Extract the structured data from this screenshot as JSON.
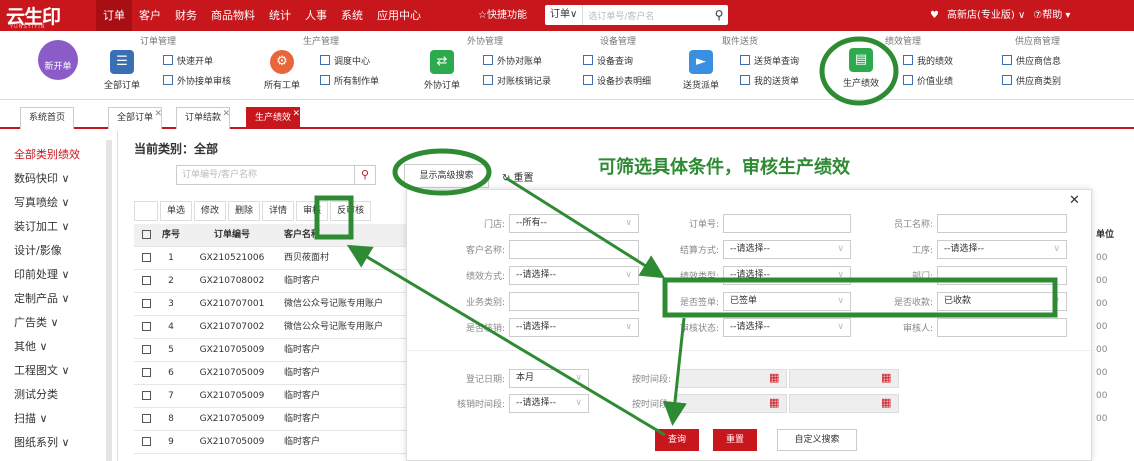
{
  "app": {
    "logo": "云生印",
    "logo_sub": "YUNSYIYIN"
  },
  "topnav": [
    "订单",
    "客户",
    "财务",
    "商品物料",
    "统计",
    "人事",
    "系统",
    "应用中心"
  ],
  "quick": "☆快捷功能",
  "search": {
    "select": "订单∨",
    "placeholder": "选订单号/客户名"
  },
  "tright": {
    "shop": "高新店(专业版) ∨",
    "help": "⑦帮助 ▾"
  },
  "ribbon": {
    "groups": [
      "订单管理",
      "生产管理",
      "外协管理",
      "设备管理",
      "取件送货",
      "绩效管理",
      "供应商管理"
    ],
    "new": "新开单",
    "all_order": "全部订单",
    "quick_open": "快速开单",
    "outsource_audit": "外协接单审核",
    "all_work": "所有工单",
    "dispatch": "调度中心",
    "all_make": "所有制作单",
    "out_order": "外协订单",
    "out_check": "外协对账单",
    "check_record": "对账核销记录",
    "dev_query": "设备查询",
    "dev_copy": "设备抄表明细",
    "send": "送货派单",
    "send_query": "送货单查询",
    "my_send": "我的送货单",
    "perf": "生产绩效",
    "my_perf": "我的绩效",
    "value_perf": "价值业绩",
    "sup_info": "供应商信息",
    "sup_type": "供应商类别"
  },
  "tabs": [
    "系统首页",
    "全部订单",
    "订单结款",
    "生产绩效"
  ],
  "sidebar": [
    "全部类别绩效",
    "数码快印 ∨",
    "写真喷绘 ∨",
    "装订加工 ∨",
    "设计/影像",
    "印前处理 ∨",
    "定制产品 ∨",
    "广告类 ∨",
    "其他 ∨",
    "工程图文 ∨",
    "测试分类",
    "扫描 ∨",
    "图纸系列 ∨"
  ],
  "main": {
    "category": "当前类别：全部",
    "order_ph": "订单编号/客户名称",
    "adv": "显示高级搜索",
    "reset": "↻ 重置",
    "tools": [
      "单选",
      "修改",
      "删除",
      "详情",
      "审核",
      "反审核"
    ],
    "head": [
      "序号",
      "订单编号",
      "客户名称"
    ],
    "unit": "单位",
    "rows": [
      [
        "1",
        "GX210521006",
        "西贝莜面村"
      ],
      [
        "2",
        "GX210708002",
        "临时客户"
      ],
      [
        "3",
        "GX210707001",
        "微信公众号记账专用账户"
      ],
      [
        "4",
        "GX210707002",
        "微信公众号记账专用账户"
      ],
      [
        "5",
        "GX210705009",
        "临时客户"
      ],
      [
        "6",
        "GX210705009",
        "临时客户"
      ],
      [
        "7",
        "GX210705009",
        "临时客户"
      ],
      [
        "8",
        "GX210705009",
        "临时客户"
      ],
      [
        "9",
        "GX210705009",
        "临时客户"
      ]
    ],
    "rcol": [
      "00",
      "00",
      "00",
      "00",
      "00",
      "00",
      "00",
      "00",
      "00"
    ]
  },
  "annotation": "可筛选具体条件，审核生产绩效",
  "panel": {
    "store_l": "门店:",
    "store": "--所有--",
    "order_l": "订单号:",
    "staff_l": "员工名称:",
    "cust_l": "客户名称:",
    "settle_l": "结算方式:",
    "settle": "--请选择--",
    "proc_l": "工序:",
    "proc": "--请选择--",
    "pmode_l": "绩效方式:",
    "pmode": "--请选择--",
    "ptype_l": "绩效类型:",
    "ptype": "--请选择--",
    "dept_l": "部门:",
    "biz_l": "业务类别:",
    "sign_l": "是否签单:",
    "sign": "已签单",
    "paid_l": "是否收款:",
    "paid": "已收款",
    "verify_l": "是否核销:",
    "verify": "--请选择--",
    "audit_l": "审核状态:",
    "audit": "--请选择--",
    "auditor_l": "审核人:",
    "reg_l": "登记日期:",
    "reg": "本月",
    "time_l": "按时间段:",
    "ver_l": "核销时间段:",
    "ver": "--请选择--",
    "time2_l": "按时间段:",
    "btn_q": "查询",
    "btn_r": "重置",
    "btn_c": "自定义搜索"
  }
}
